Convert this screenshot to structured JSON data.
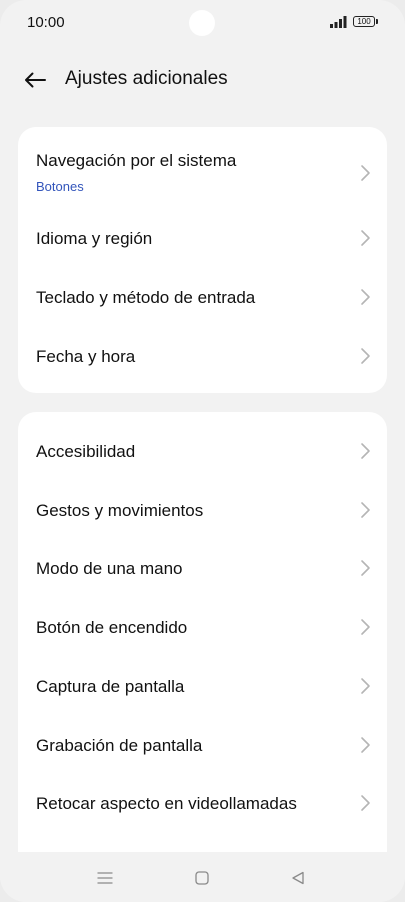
{
  "status_bar": {
    "time": "10:00",
    "battery": "100"
  },
  "header": {
    "title": "Ajustes adicionales"
  },
  "groups": [
    {
      "items": [
        {
          "label": "Navegación por el sistema",
          "sublabel": "Botones"
        },
        {
          "label": "Idioma y región"
        },
        {
          "label": "Teclado y método de entrada"
        },
        {
          "label": "Fecha y hora"
        }
      ]
    },
    {
      "items": [
        {
          "label": "Accesibilidad"
        },
        {
          "label": "Gestos y movimientos"
        },
        {
          "label": "Modo de una mano"
        },
        {
          "label": "Botón de encendido"
        },
        {
          "label": "Captura de pantalla"
        },
        {
          "label": "Grabación de pantalla"
        },
        {
          "label": "Retocar aspecto en videollamadas"
        }
      ]
    }
  ],
  "colors": {
    "accent": "#3355bb",
    "background": "#f2f2f2",
    "card": "#ffffff"
  }
}
